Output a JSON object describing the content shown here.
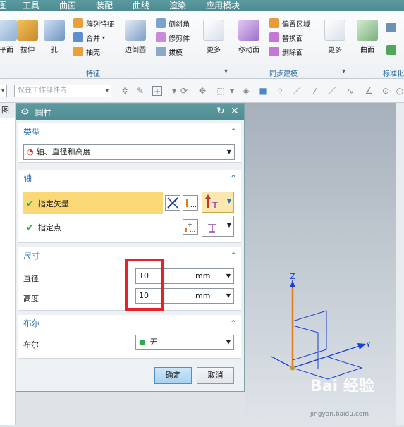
{
  "menubar": {
    "items": [
      "图",
      "工具",
      "曲面",
      "装配",
      "曲线",
      "渲染",
      "应用模块"
    ]
  },
  "ribbon": {
    "feature_group": {
      "label": "特征",
      "buttons": [
        "平面",
        "拉伸",
        "孔"
      ],
      "small": [
        "阵列特征",
        "合并",
        "抽壳"
      ],
      "edge_label": "边倒圆",
      "small2": [
        "倒斜角",
        "修剪体",
        "拔模"
      ],
      "more": "更多"
    },
    "sync_group": {
      "label": "同步建模",
      "move_face": "移动面",
      "small": [
        "偏置区域",
        "替换面",
        "删除面"
      ],
      "more": "更多"
    },
    "surface": "曲面",
    "standard_label": "标准化"
  },
  "toolbar": {
    "filter_placeholder": "仅在工作部件内"
  },
  "dialog": {
    "title": "圆柱",
    "type_section": {
      "title": "类型",
      "selected": "轴、直径和高度"
    },
    "axis_section": {
      "title": "轴",
      "specify_vector": "指定矢量",
      "specify_point": "指定点"
    },
    "dim_section": {
      "title": "尺寸",
      "diameter_label": "直径",
      "diameter_value": "10",
      "diameter_unit": "mm",
      "height_label": "高度",
      "height_value": "10",
      "height_unit": "mm"
    },
    "bool_section": {
      "title": "布尔",
      "label": "布尔",
      "selected": "无"
    },
    "ok": "确定",
    "cancel": "取消"
  },
  "viewport": {
    "axis_z": "Z",
    "axis_y": "Y",
    "axis_x": "X"
  },
  "watermark": {
    "main": "Bai 经验",
    "sub": "jingyan.baidu.com"
  },
  "colors": {
    "title_bar": "#5299a0",
    "section_title": "#2b74b8",
    "highlight_row": "#fbd876",
    "redbox": "#e2242a",
    "axis_blue": "#1a3fd6",
    "axis_orange": "#e37b1c"
  }
}
